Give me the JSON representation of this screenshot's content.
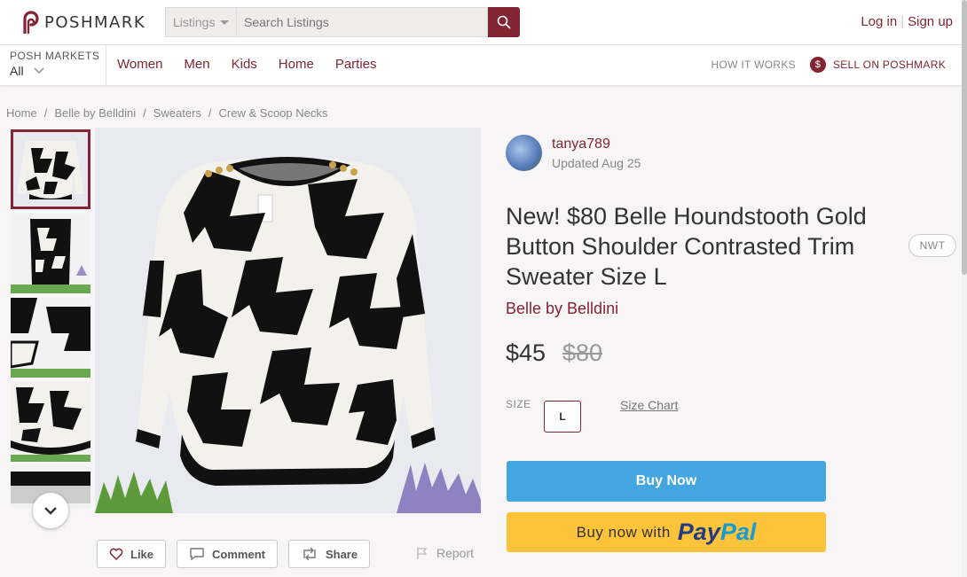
{
  "header": {
    "logo_text": "POSHMARK",
    "search_category": "Listings",
    "search_placeholder": "Search Listings",
    "login": "Log in",
    "signup": "Sign up"
  },
  "nav": {
    "markets_label": "POSH MARKETS",
    "markets_value": "All",
    "links": [
      "Women",
      "Men",
      "Kids",
      "Home",
      "Parties"
    ],
    "how_it_works": "HOW IT WORKS",
    "sell": "SELL ON POSHMARK"
  },
  "breadcrumb": [
    "Home",
    "Belle by Belldini",
    "Sweaters",
    "Crew & Scoop Necks"
  ],
  "listing": {
    "seller": "tanya789",
    "updated": "Updated Aug 25",
    "title": "New! $80 Belle Houndstooth Gold Button Shoulder Contrasted Trim Sweater Size L",
    "badge": "NWT",
    "brand": "Belle by Belldini",
    "price": "$45",
    "original_price": "$80",
    "size_label": "SIZE",
    "size": "L",
    "size_chart": "Size Chart",
    "buy_now": "Buy Now",
    "paypal_text": "Buy now with",
    "paypal_logo_1": "Pay",
    "paypal_logo_2": "Pal"
  },
  "actions": {
    "like": "Like",
    "comment": "Comment",
    "share": "Share",
    "report": "Report"
  },
  "colors": {
    "brand": "#822432",
    "buy_now": "#44a6e0",
    "paypal": "#fdc33b"
  }
}
